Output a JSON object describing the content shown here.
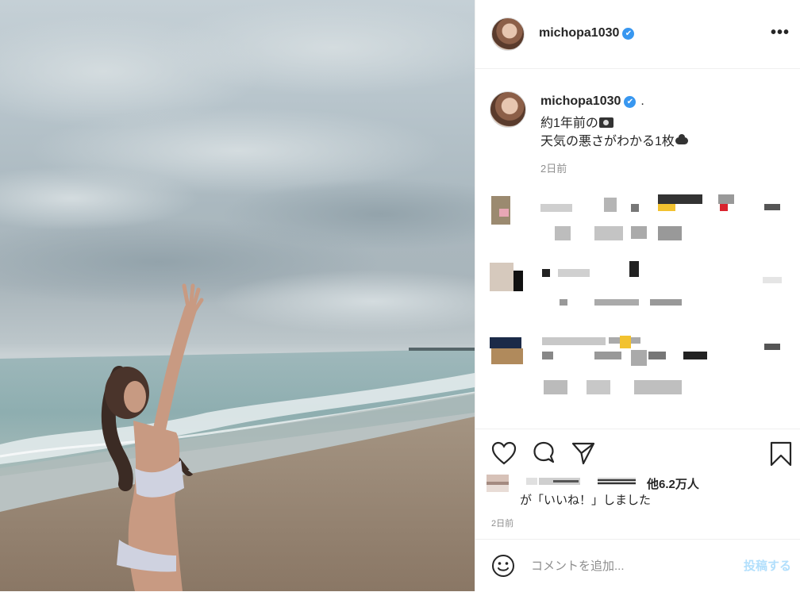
{
  "post": {
    "username": "michopa1030",
    "verified_icon": "verified-badge-icon",
    "caption_suffix": ".",
    "caption_line1": "約1年前の",
    "caption_line2": "天気の悪さがわかる1枚",
    "caption_time": "2日前"
  },
  "header": {
    "username": "michopa1030",
    "more_label": "•••"
  },
  "icons": {
    "verified": "✔",
    "heart": "heart-icon",
    "comment": "comment-icon",
    "share": "share-icon",
    "bookmark": "bookmark-icon",
    "emoji": "emoji-icon"
  },
  "likes": {
    "count_label": "他6.2万人",
    "text": "が「いいね！」しました",
    "time": "2日前"
  },
  "comment_box": {
    "placeholder": "コメントを追加...",
    "post_label": "投稿する"
  },
  "colors": {
    "verified": "#3897f0",
    "post_button_disabled": "#b2dffc",
    "muted_text": "#8e8e8e"
  }
}
